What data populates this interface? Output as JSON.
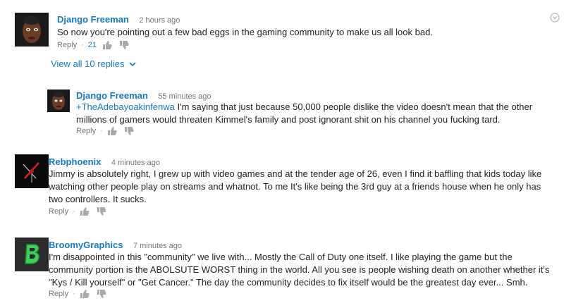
{
  "comments": [
    {
      "author": "Django Freeman",
      "time": "2 hours ago",
      "text": "So now you're pointing out a few bad eggs in the gaming community to make us all look bad.",
      "reply_label": "Reply",
      "likes": "21"
    },
    {
      "author": "Django Freeman",
      "time": "55 minutes ago",
      "mention": "+TheAdebayoakinfenwa",
      "text": " I'm saying that just because 50,000 people dislike the video doesn't mean that the other millions of gamers would threaten Kimmel's family and post ignorant shit on his channel you fucking tard.",
      "reply_label": "Reply"
    },
    {
      "author": "Rebphoenix",
      "time": "4 minutes ago",
      "text": "Jimmy is absolutely right, I grew up with video games and at the tender age of 26, even I find it baffling that kids today like watching other people play on streams and whatnot. To me It's like being the 3rd guy at a friends house when he only has two controllers. It sucks.",
      "reply_label": "Reply"
    },
    {
      "author": "BroomyGraphics",
      "time": "7 minutes ago",
      "text": "I'm disappointed in this \"community\" we live with... Mostly the Call of Duty one itself. I like playing the game but the community portion is the ABOLSUTE WORST thing in the world. All you see is people wishing death on another whether it's \"Kys / Kill yourself\" or \"Get Cancer.\" The day the community decides to fix itself would be the greatest day ever... Smh.",
      "reply_label": "Reply"
    }
  ],
  "view_replies_label": "View all 10 replies",
  "colors": {
    "link": "#167ac6",
    "meta": "#767676"
  },
  "icons": [
    "thumb-up-icon",
    "thumb-down-icon",
    "chevron-down-icon",
    "comment-menu-icon"
  ]
}
